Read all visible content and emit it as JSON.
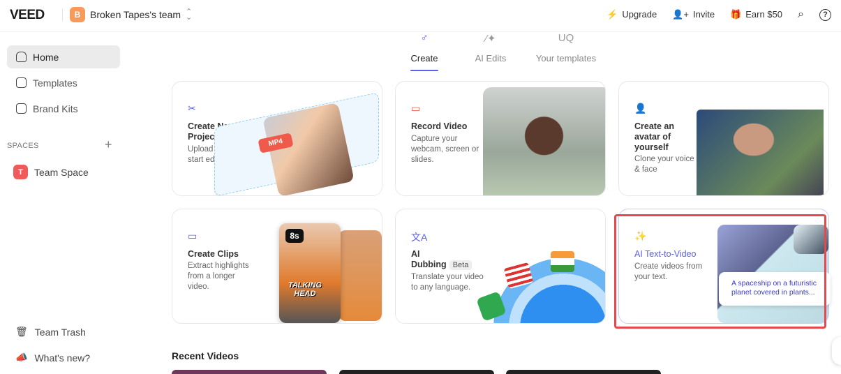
{
  "header": {
    "logo": "VEED",
    "team_initial": "B",
    "team_name": "Broken Tapes's team",
    "upgrade": "Upgrade",
    "invite": "Invite",
    "earn": "Earn $50"
  },
  "sidebar": {
    "items": [
      {
        "label": "Home"
      },
      {
        "label": "Templates"
      },
      {
        "label": "Brand Kits"
      }
    ],
    "spaces_label": "SPACES",
    "team_space_initial": "T",
    "team_space": "Team Space",
    "trash": "Team Trash",
    "whats_new": "What's new?"
  },
  "tabs": [
    {
      "label": "Create"
    },
    {
      "label": "AI Edits"
    },
    {
      "label": "Your templates"
    }
  ],
  "cards": [
    {
      "title": "Create New Project",
      "desc": "Upload your files and start editing.",
      "badge": "MP4"
    },
    {
      "title": "Record Video",
      "desc": "Capture your webcam, screen or slides."
    },
    {
      "title": "Create an avatar of yourself",
      "desc": "Clone your voice & face"
    },
    {
      "title": "Create Clips",
      "desc": "Extract highlights from a longer video.",
      "badge": "8s",
      "overlay": "TALKING HEAD"
    },
    {
      "title": "AI Dubbing",
      "beta": "Beta",
      "desc": "Translate your video to any language."
    },
    {
      "title": "AI Text-to-Video",
      "desc": "Create videos from your text.",
      "caption": "A spaceship on a futuristic planet covered in plants..."
    }
  ],
  "recent": {
    "title": "Recent Videos"
  },
  "colors": {
    "accent": "#5b5fef",
    "highlight": "#e5484d"
  }
}
